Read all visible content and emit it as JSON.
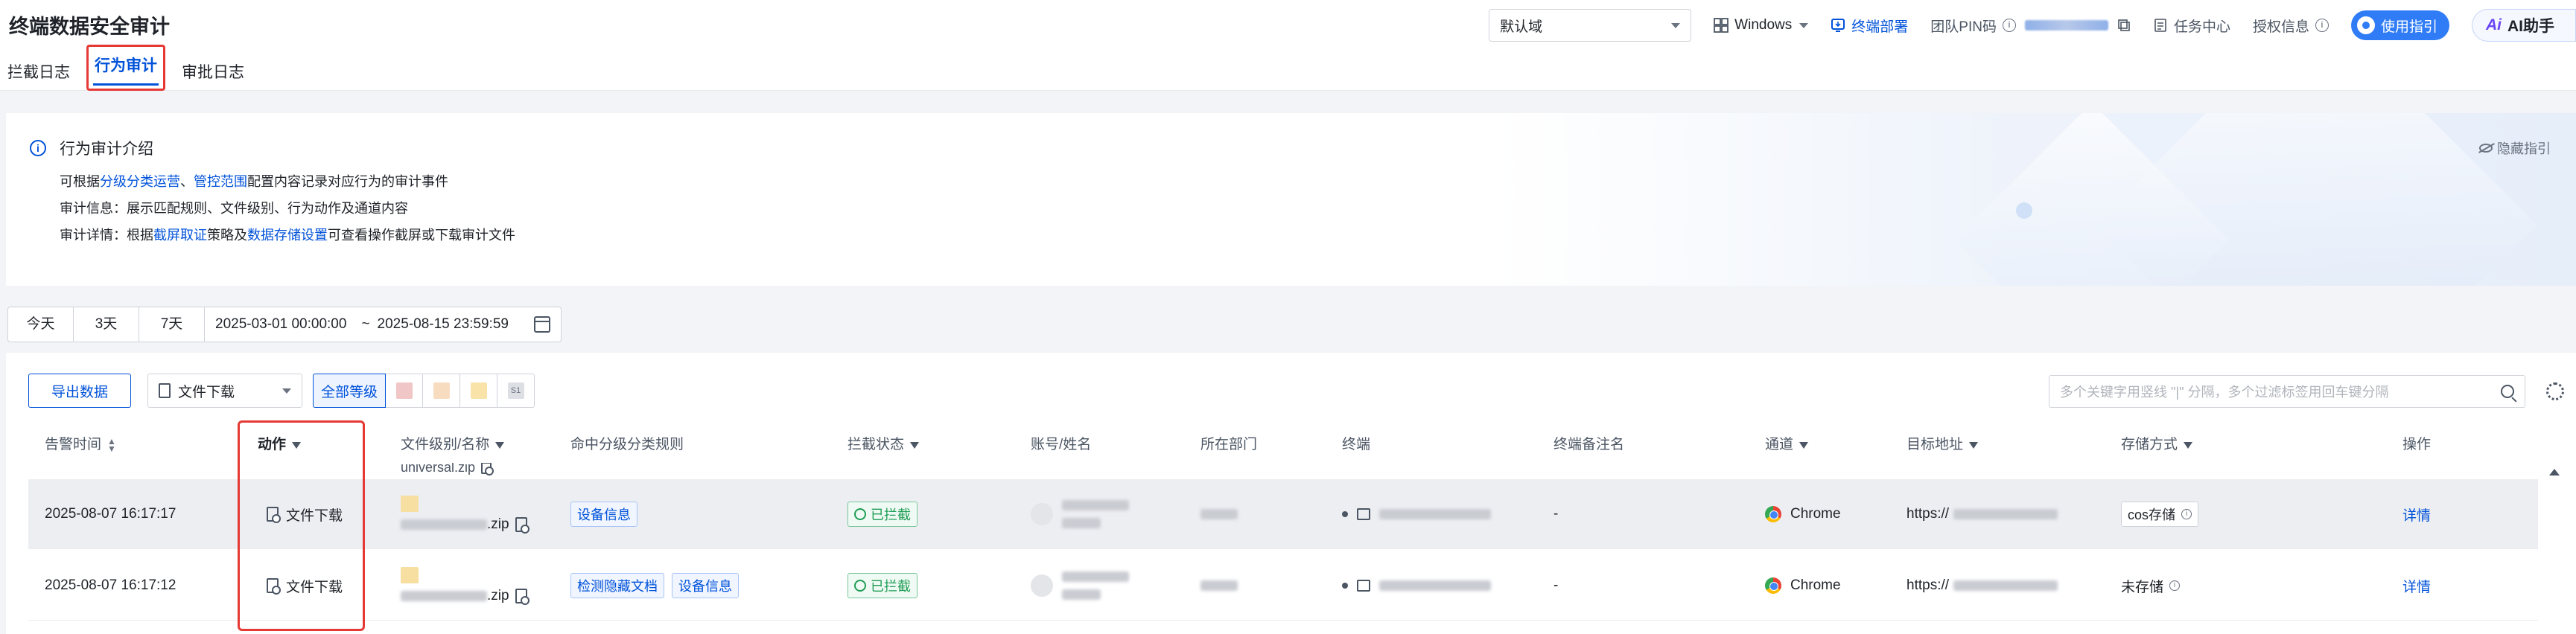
{
  "header": {
    "title": "终端数据安全审计",
    "tabs": [
      {
        "label": "拦截日志",
        "active": false
      },
      {
        "label": "行为审计",
        "active": true
      },
      {
        "label": "审批日志",
        "active": false
      }
    ],
    "domain_select": "默认域",
    "os_select": "Windows",
    "deploy_label": "终端部署",
    "team_pin_label": "团队PIN码",
    "task_center": "任务中心",
    "license_info": "授权信息",
    "guide_button": "使用指引",
    "ai_button": "AI助手",
    "ai_logo_text": "Ai"
  },
  "intro": {
    "title": "行为审计介绍",
    "hide_label": "隐藏指引",
    "line1": {
      "pre": "可根据",
      "link1": "分级分类运营",
      "sep": "、",
      "link2": "管控范围",
      "post": "配置内容记录对应行为的审计事件"
    },
    "line2": "审计信息：展示匹配规则、文件级别、行为动作及通道内容",
    "line3": {
      "pre": "审计详情：根据",
      "link1": "截屏取证",
      "mid": "策略及",
      "link2": "数据存储设置",
      "post": "可查看操作截屏或下载审计文件"
    }
  },
  "datebar": {
    "quick": [
      "今天",
      "3天",
      "7天"
    ],
    "start": "2025-03-01 00:00:00",
    "sep": "~",
    "end": "2025-08-15 23:59:59"
  },
  "toolbar": {
    "export_label": "导出数据",
    "action_select": "文件下载",
    "level_all": "全部等级",
    "level_colors": [
      "#f0c6c6",
      "#f8dcc0",
      "#f9e3a8",
      "#dddfe4"
    ],
    "level_badge": "S1",
    "search_placeholder": "多个关键字用竖线 \"|\" 分隔，多个过滤标签用回车键分隔"
  },
  "table": {
    "columns": [
      "告警时间",
      "动作",
      "文件级别/名称",
      "命中分级分类规则",
      "拦截状态",
      "账号/姓名",
      "所在部门",
      "终端",
      "终端备注名",
      "通道",
      "目标地址",
      "存储方式",
      "操作"
    ],
    "partial_row_file": "universal.zip",
    "rows": [
      {
        "time": "2025-08-07 16:17:17",
        "action": "文件下载",
        "file_ext": ".zip",
        "rules": [
          "设备信息"
        ],
        "status": "已拦截",
        "remark": "-",
        "channel": "Chrome",
        "target_prefix": "https://",
        "storage": "cos存储",
        "op": "详情"
      },
      {
        "time": "2025-08-07 16:17:12",
        "action": "文件下载",
        "file_ext": ".zip",
        "rules": [
          "检测隐藏文档",
          "设备信息"
        ],
        "status": "已拦截",
        "remark": "-",
        "channel": "Chrome",
        "target_prefix": "https://",
        "storage": "未存储",
        "op": "详情"
      }
    ]
  },
  "colors": {
    "primary": "#0052d9",
    "highlight_border": "#e53935",
    "success": "#1f9d55"
  }
}
